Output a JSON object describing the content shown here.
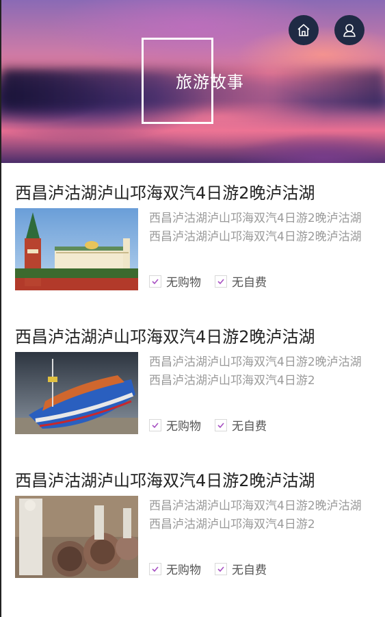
{
  "header": {
    "title": "旅游故事",
    "home_icon": "home-icon",
    "user_icon": "user-icon"
  },
  "stories": [
    {
      "title": "西昌泸沽湖泸山邛海双汽4日游2晚泸沽湖",
      "description": "西昌泸沽湖泸山邛海双汽4日游2晚泸沽湖西昌泸沽湖泸山邛海双汽4日游2晚泸沽湖",
      "tag1": "无购物",
      "tag2": "无自费",
      "image": "kremlin"
    },
    {
      "title": "西昌泸沽湖泸山邛海双汽4日游2晚泸沽湖",
      "description": "西昌泸沽湖泸山邛海双汽4日游2晚泸沽湖西昌泸沽湖泸山邛海双汽4日游2",
      "tag1": "无购物",
      "tag2": "无自费",
      "image": "boat"
    },
    {
      "title": "西昌泸沽湖泸山邛海双汽4日游2晚泸沽湖",
      "description": "西昌泸沽湖泸山邛海双汽4日游2晚泸沽湖西昌泸沽湖泸山邛海双汽4日游2",
      "tag1": "无购物",
      "tag2": "无自费",
      "image": "statues"
    }
  ],
  "colors": {
    "check": "#a64fc2",
    "title": "#222222",
    "desc": "#9a9a9a"
  }
}
